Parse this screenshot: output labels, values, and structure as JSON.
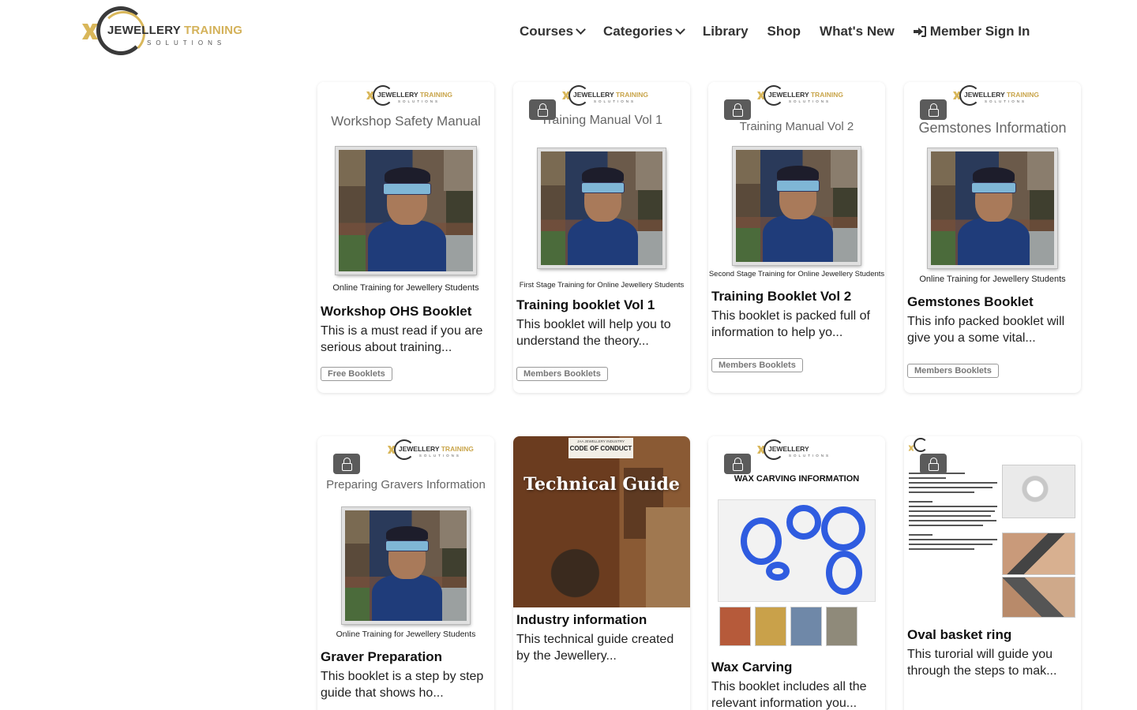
{
  "header": {
    "logo": {
      "word_main": "JEWELLERY",
      "word_gold": "TRAINING",
      "word_sub": "SOLUTIONS"
    },
    "nav": [
      {
        "label": "Courses",
        "dropdown": true
      },
      {
        "label": "Categories",
        "dropdown": true
      },
      {
        "label": "Library",
        "dropdown": false
      },
      {
        "label": "Shop",
        "dropdown": false
      },
      {
        "label": "What's New",
        "dropdown": false
      }
    ],
    "signin_label": "Member Sign In"
  },
  "cover_logo": {
    "main": "JEWELLERY",
    "gold": "TRAINING",
    "sub": "SOLUTIONS"
  },
  "cards": [
    {
      "cover_title": "Workshop Safety Manual",
      "cover_sub": "Online Training for Jewellery Students",
      "title": "Workshop OHS Booklet",
      "description": "This is a must read if you are serious about training...",
      "tag": "Free Booklets",
      "locked": false
    },
    {
      "cover_title": "Training Manual Vol 1",
      "cover_sub": "First Stage Training for Online Jewellery Students",
      "title": "Training booklet Vol 1",
      "description": "This booklet will help you to understand the theory...",
      "tag": "Members Booklets",
      "locked": true
    },
    {
      "cover_title": "Training Manual Vol 2",
      "cover_sub": "Second Stage Training for Online Jewellery Students",
      "title": "Training Booklet Vol 2",
      "description": "This booklet is packed full of information to help yo...",
      "tag": "Members Booklets",
      "locked": true
    },
    {
      "cover_title": "Gemstones Information",
      "cover_sub": "Online Training for Jewellery Students",
      "title": "Gemstones Booklet",
      "description": "This info packed booklet will give you a some vital...",
      "tag": "Members Booklets",
      "locked": true
    },
    {
      "cover_title": "Preparing Gravers Information",
      "cover_sub": "Online Training for Jewellery Students",
      "title": "Graver Preparation",
      "description": "This booklet is a step by step guide that shows ho...",
      "locked": true
    },
    {
      "cover_badge_line1": "JAA JEWELLERY INDUSTRY",
      "cover_badge_line2": "CODE OF CONDUCT",
      "cover_title": "Technical Guide",
      "title": "Industry information",
      "description": "This technical guide created by the Jewellery...",
      "locked": false
    },
    {
      "cover_title": "WAX CARVING INFORMATION",
      "title": "Wax Carving",
      "description": "This booklet includes all the relevant information you...",
      "locked": true
    },
    {
      "cover_title": "Oval basket ring",
      "title": "Oval basket ring",
      "description": "This turorial will guide you through the steps to mak...",
      "locked": true
    }
  ],
  "colors": {
    "gold": "#d4b25a",
    "dark": "#333333",
    "lock_bg": "#5b5b5b",
    "wax_blue": "#2f5ce0"
  }
}
